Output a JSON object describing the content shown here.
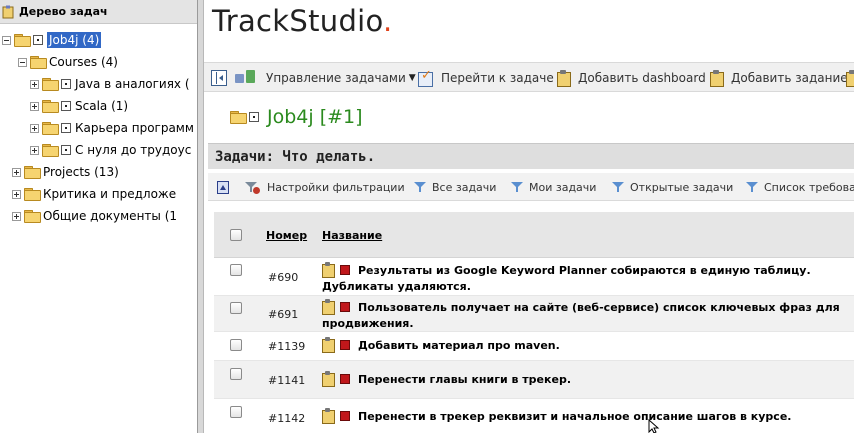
{
  "sidebar": {
    "title": "Дерево задач",
    "tree": [
      {
        "label": "Job4j (4)",
        "expander": "minus",
        "selected": true
      },
      {
        "label": "Courses (4)",
        "expander": "minus"
      },
      {
        "label": "Java в аналогиях (",
        "expander": "plus"
      },
      {
        "label": "Scala (1)",
        "expander": "plus"
      },
      {
        "label": "Карьера программ",
        "expander": "plus"
      },
      {
        "label": "С нуля до трудоус",
        "expander": "plus"
      },
      {
        "label": "Projects (13)",
        "expander": "plus"
      },
      {
        "label": "Критика и предложе",
        "expander": "plus"
      },
      {
        "label": "Общие документы (1",
        "expander": "plus"
      }
    ]
  },
  "logo": {
    "text": "TrackStudio",
    "dot": "."
  },
  "toolbar": {
    "manage": "Управление задачами",
    "goto": "Перейти к задаче",
    "add_dashboard": "Добавить dashboard",
    "add_task": "Добавить задание"
  },
  "task": {
    "title": "Job4j [#1]"
  },
  "section": {
    "title": "Задачи: Что делать."
  },
  "filters": {
    "settings": "Настройки фильтрации",
    "all": "Все задачи",
    "mine": "Мои задачи",
    "open": "Открытые задачи",
    "requirements": "Список требова"
  },
  "table": {
    "headers": {
      "number": "Номер",
      "name": "Название"
    },
    "rows": [
      {
        "number": "#690",
        "name": "Результаты из Google Keyword Planner собираются в единую таблицу. Дубликаты удаляются."
      },
      {
        "number": "#691",
        "name": "Пользователь получает на сайте (веб-сервисе) список ключевых фраз для продвижения."
      },
      {
        "number": "#1139",
        "name": "Добавить материал про maven."
      },
      {
        "number": "#1141",
        "name": "Перенести главы книги в трекер."
      },
      {
        "number": "#1142",
        "name": "Перенести в трекер реквизит и начальное описание шагов в курсе."
      }
    ]
  },
  "colors": {
    "logo_dot": "#e0421b",
    "task_title": "#2b8a1e",
    "selected_node": "#3168c6",
    "priority": "#c0171b"
  }
}
